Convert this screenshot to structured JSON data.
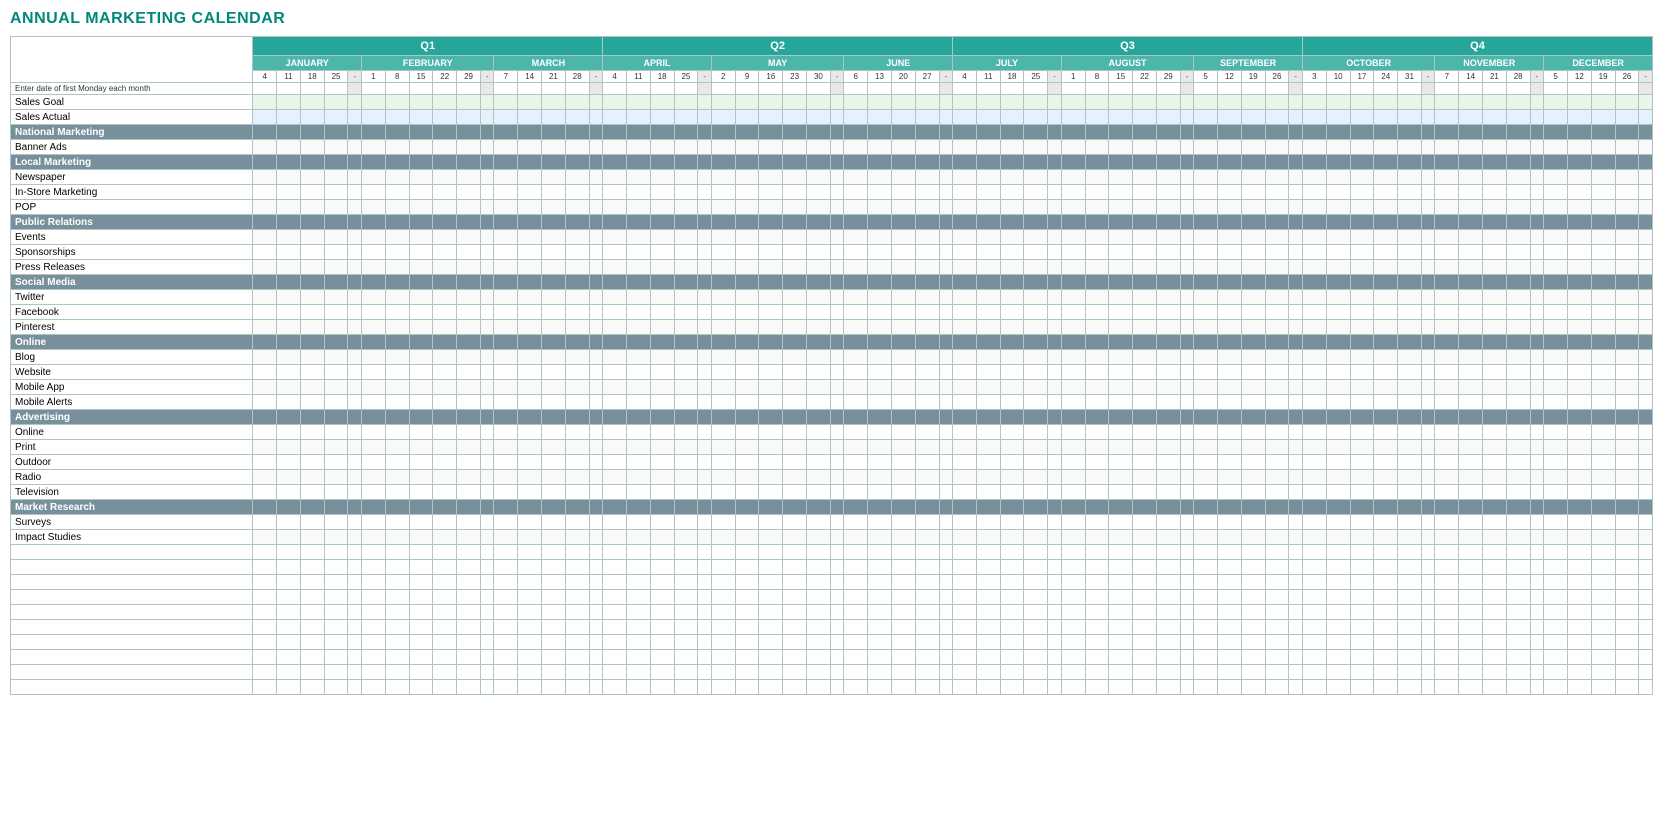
{
  "title": "ANNUAL MARKETING CALENDAR",
  "quarters": [
    {
      "label": "Q1",
      "span": 16
    },
    {
      "label": "Q2",
      "span": 16
    },
    {
      "label": "Q3",
      "span": 16
    },
    {
      "label": "Q4",
      "span": 16
    }
  ],
  "months": [
    {
      "label": "JANUARY",
      "dates": [
        "4",
        "11",
        "18",
        "25"
      ],
      "sep": "-",
      "q": 1
    },
    {
      "label": "FEBRUARY",
      "dates": [
        "1",
        "8",
        "15",
        "22",
        "29"
      ],
      "sep": "-",
      "q": 1
    },
    {
      "label": "MARCH",
      "dates": [
        "7",
        "14",
        "21",
        "28"
      ],
      "sep": "-",
      "q": 1
    },
    {
      "label": "APRIL",
      "dates": [
        "4",
        "11",
        "18",
        "25"
      ],
      "sep": "-",
      "q": 2
    },
    {
      "label": "MAY",
      "dates": [
        "2",
        "9",
        "16",
        "23",
        "30"
      ],
      "sep": "-",
      "q": 2
    },
    {
      "label": "JUNE",
      "dates": [
        "6",
        "13",
        "20",
        "27"
      ],
      "sep": "-",
      "q": 2
    },
    {
      "label": "JULY",
      "dates": [
        "4",
        "11",
        "18",
        "25"
      ],
      "sep": "-",
      "q": 3
    },
    {
      "label": "AUGUST",
      "dates": [
        "1",
        "8",
        "15",
        "22",
        "29"
      ],
      "sep": "-",
      "q": 3
    },
    {
      "label": "SEPTEMBER",
      "dates": [
        "5",
        "12",
        "19",
        "26"
      ],
      "sep": "-",
      "q": 3
    },
    {
      "label": "OCTOBER",
      "dates": [
        "3",
        "10",
        "17",
        "24",
        "31"
      ],
      "sep": "-",
      "q": 4
    },
    {
      "label": "NOVEMBER",
      "dates": [
        "7",
        "14",
        "21",
        "28"
      ],
      "sep": "-",
      "q": 4
    },
    {
      "label": "DECEMBER",
      "dates": [
        "5",
        "12",
        "19",
        "26"
      ],
      "sep": "-",
      "q": 4
    }
  ],
  "instruction": "Enter date of first Monday each month",
  "rows": [
    {
      "type": "special",
      "label": "Sales Goal"
    },
    {
      "type": "special",
      "label": "Sales Actual"
    },
    {
      "type": "section",
      "label": "National Marketing"
    },
    {
      "type": "item",
      "label": "Banner Ads"
    },
    {
      "type": "section",
      "label": "Local Marketing"
    },
    {
      "type": "item",
      "label": "Newspaper"
    },
    {
      "type": "item",
      "label": "In-Store Marketing"
    },
    {
      "type": "item",
      "label": "POP"
    },
    {
      "type": "section",
      "label": "Public Relations"
    },
    {
      "type": "item",
      "label": "Events"
    },
    {
      "type": "item",
      "label": "Sponsorships"
    },
    {
      "type": "item",
      "label": "Press Releases"
    },
    {
      "type": "section",
      "label": "Social Media"
    },
    {
      "type": "item",
      "label": "Twitter"
    },
    {
      "type": "item",
      "label": "Facebook"
    },
    {
      "type": "item",
      "label": "Pinterest"
    },
    {
      "type": "section",
      "label": "Online"
    },
    {
      "type": "item",
      "label": "Blog"
    },
    {
      "type": "item",
      "label": "Website"
    },
    {
      "type": "item",
      "label": "Mobile App"
    },
    {
      "type": "item",
      "label": "Mobile Alerts"
    },
    {
      "type": "section",
      "label": "Advertising"
    },
    {
      "type": "item",
      "label": "Online"
    },
    {
      "type": "item",
      "label": "Print"
    },
    {
      "type": "item",
      "label": "Outdoor"
    },
    {
      "type": "item",
      "label": "Radio"
    },
    {
      "type": "item",
      "label": "Television"
    },
    {
      "type": "section",
      "label": "Market Research"
    },
    {
      "type": "item",
      "label": "Surveys"
    },
    {
      "type": "item",
      "label": "Impact Studies"
    },
    {
      "type": "empty",
      "label": ""
    },
    {
      "type": "empty",
      "label": ""
    },
    {
      "type": "empty",
      "label": ""
    },
    {
      "type": "empty",
      "label": ""
    },
    {
      "type": "empty",
      "label": ""
    },
    {
      "type": "empty",
      "label": ""
    },
    {
      "type": "empty",
      "label": ""
    },
    {
      "type": "empty",
      "label": ""
    },
    {
      "type": "empty",
      "label": ""
    },
    {
      "type": "empty",
      "label": ""
    }
  ]
}
